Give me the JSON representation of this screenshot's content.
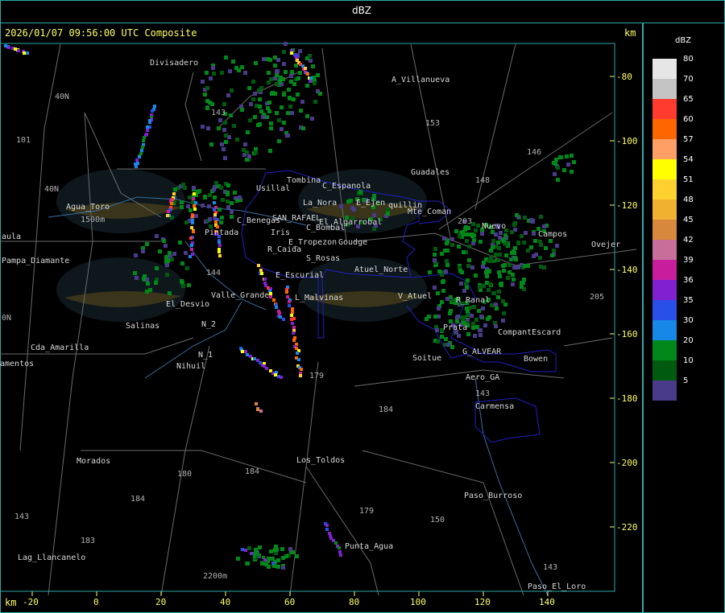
{
  "title": "dBZ",
  "header": {
    "timestamp": "2026/01/07 09:56:00 UTC Composite",
    "unit_right": "km"
  },
  "footer": {
    "unit_left": "km"
  },
  "legend": {
    "title": "dBZ",
    "items": [
      {
        "label": "80",
        "color": "#e6e6e6"
      },
      {
        "label": "70",
        "color": "#c4c4c4"
      },
      {
        "label": "65",
        "color": "#ff3b2f"
      },
      {
        "label": "60",
        "color": "#ff6600"
      },
      {
        "label": "57",
        "color": "#ff9f66"
      },
      {
        "label": "54",
        "color": "#ffff00"
      },
      {
        "label": "51",
        "color": "#ffd030"
      },
      {
        "label": "48",
        "color": "#f0b030"
      },
      {
        "label": "45",
        "color": "#d8883c"
      },
      {
        "label": "42",
        "color": "#c86e9a"
      },
      {
        "label": "39",
        "color": "#c81e9e"
      },
      {
        "label": "36",
        "color": "#8020d0"
      },
      {
        "label": "35",
        "color": "#2850e8"
      },
      {
        "label": "30",
        "color": "#1888e8"
      },
      {
        "label": "20",
        "color": "#00881a"
      },
      {
        "label": "10",
        "color": "#005a10"
      },
      {
        "label": "5",
        "color": "#4a3a8a"
      }
    ]
  },
  "axes": {
    "x_ticks": [
      "-20",
      "0",
      "20",
      "40",
      "60",
      "80",
      "100",
      "120",
      "140"
    ],
    "y_ticks": [
      "-80",
      "-100",
      "-120",
      "-140",
      "-160",
      "-180",
      "-200",
      "-220"
    ]
  },
  "places": [
    {
      "name": "Divisadero"
    },
    {
      "name": "A_Villanueva"
    },
    {
      "name": "Guadales"
    },
    {
      "name": "Agua_Toro"
    },
    {
      "name": "aula"
    },
    {
      "name": "Pampa_Diamante"
    },
    {
      "name": "Cda_Amarilla"
    },
    {
      "name": "amentos"
    },
    {
      "name": "El_Desvio"
    },
    {
      "name": "Salinas"
    },
    {
      "name": "N_2"
    },
    {
      "name": "N_1"
    },
    {
      "name": "Nihuil"
    },
    {
      "name": "Usillal"
    },
    {
      "name": "Tombina"
    },
    {
      "name": "C_Espanola"
    },
    {
      "name": "E_Ejen"
    },
    {
      "name": "quillin"
    },
    {
      "name": "Mte_Coman"
    },
    {
      "name": "C_Benegas"
    },
    {
      "name": "SAN_RAFAEL"
    },
    {
      "name": "El_Algarrobal"
    },
    {
      "name": "C_Bombal"
    },
    {
      "name": "Pintada"
    },
    {
      "name": "Iris"
    },
    {
      "name": "E_Tropezon"
    },
    {
      "name": "Goudge"
    },
    {
      "name": "R_Caida"
    },
    {
      "name": "S_Rosas"
    },
    {
      "name": "La_Nora"
    },
    {
      "name": "Atuel_Norte"
    },
    {
      "name": "E_Escurial"
    },
    {
      "name": "Valle_Grande"
    },
    {
      "name": "L_Malvinas"
    },
    {
      "name": "V_Atuel"
    },
    {
      "name": "R_Ranal"
    },
    {
      "name": "Prata"
    },
    {
      "name": "CompantEscard"
    },
    {
      "name": "G_ALVEAR"
    },
    {
      "name": "Soitue"
    },
    {
      "name": "Bowen"
    },
    {
      "name": "Aero_GA"
    },
    {
      "name": "Carmensa"
    },
    {
      "name": "Morados"
    },
    {
      "name": "Los_Toldos"
    },
    {
      "name": "Paso_Burroso"
    },
    {
      "name": "Punta_Agua"
    },
    {
      "name": "Lag_Llancanelo"
    },
    {
      "name": "Paso_El_Loro"
    },
    {
      "name": "Ovejer"
    },
    {
      "name": "Campos"
    },
    {
      "name": "Nuevo"
    }
  ],
  "routes": [
    "40N",
    "40N",
    "101",
    "143",
    "153",
    "146",
    "148",
    "203",
    "205",
    "143",
    "144",
    "179",
    "184",
    "184",
    "180",
    "184",
    "183",
    "179",
    "150",
    "143",
    "143",
    "1500m",
    "2200m",
    "0N"
  ]
}
